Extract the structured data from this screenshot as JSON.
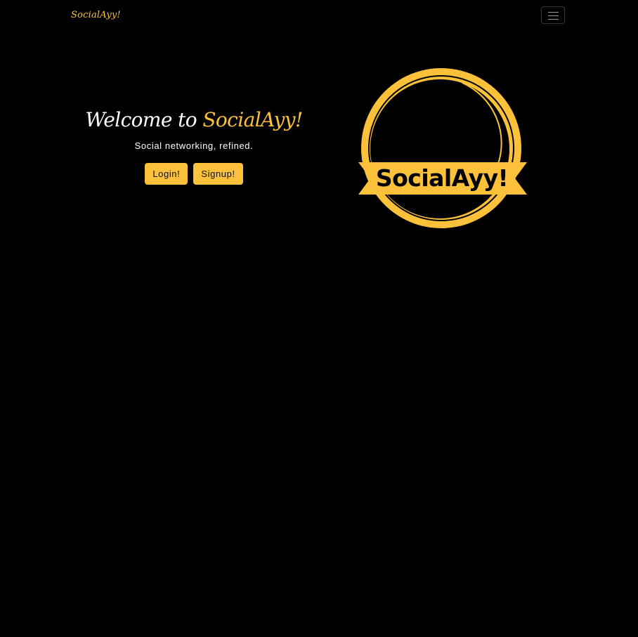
{
  "navbar": {
    "brand": "SocialAyy!",
    "toggler_icon": "hamburger-menu-icon"
  },
  "hero": {
    "title_prefix": "Welcome to ",
    "title_accent": "SocialAyy!",
    "tagline": "Social networking, refined.",
    "login_label": "Login!",
    "signup_label": "Signup!"
  },
  "logo": {
    "text": "SocialAyy!"
  },
  "colors": {
    "background": "#000000",
    "accent": "#fcc13a",
    "text": "#ffffff",
    "button_text": "#111111"
  }
}
